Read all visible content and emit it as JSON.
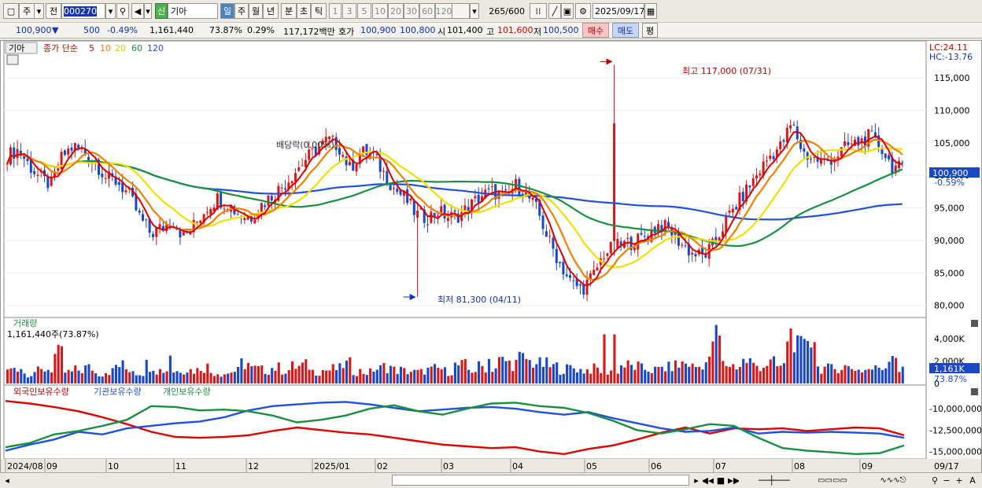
{
  "toolbar": {
    "type_label": "주",
    "prev_label": "전",
    "stock_code": "000270",
    "badge": "신",
    "stock_name": "기아",
    "periods": [
      "일",
      "주",
      "월",
      "년",
      "분",
      "초",
      "틱"
    ],
    "selected_period": "일",
    "minute_presets": [
      "1",
      "3",
      "5",
      "10",
      "20",
      "30",
      "60",
      "120"
    ],
    "count_display": "265",
    "count_max": "/600",
    "date": "2025/09/17"
  },
  "quote": {
    "price": "100,900",
    "arrow": "▼",
    "change": "500",
    "change_pct": "-0.49%",
    "volume": "1,161,440",
    "volume_ratio": "73.87%",
    "turnover": "0.29%",
    "amount": "117,172백만",
    "hoga_label": "호가",
    "ask": "100,900",
    "bid": "100,800",
    "open_label": "시",
    "open": "101,400",
    "high_label": "고",
    "high": "101,600",
    "low_label": "저",
    "low": "100,500",
    "buy_label": "매수",
    "sell_label": "매도",
    "eval_label": "평"
  },
  "price_panel": {
    "name_tag": "기아",
    "ma_title": "종가 단순",
    "ma_periods": [
      "5",
      "10",
      "20",
      "60",
      "120"
    ],
    "lc_label": "LC:24.11",
    "hc_label": "HC:-13.76",
    "y_ticks": [
      "115,000",
      "110,000",
      "105,000",
      "100,000",
      "95,000",
      "90,000",
      "85,000",
      "80,000"
    ],
    "current_price": "100,900",
    "current_pct": "-0.59%",
    "high_annotation": "최고 117,000 (07/31)",
    "low_annotation": "최저 81,300 (04/11)",
    "dividend_annotation": "배당락(0.00%)"
  },
  "volume_panel": {
    "title": "거래량",
    "value": "1,161,440주(73.87%)",
    "y_ticks": [
      "4,000K",
      "2,000K",
      "0"
    ],
    "current": "1,161K",
    "current_pct": "73.87%"
  },
  "holdings_panel": {
    "series_labels": [
      "외국인보유수량",
      "기관보유수량",
      "개인보유수량"
    ],
    "y_ticks": [
      "-10,000,000",
      "-12,500,000",
      "-15,000,000"
    ]
  },
  "x_axis": {
    "ticks": [
      "2024/08",
      "09",
      "10",
      "11",
      "12",
      "2025/01",
      "02",
      "03",
      "04",
      "05",
      "06",
      "07",
      "08",
      "09"
    ],
    "end_label": "09/17"
  },
  "colors": {
    "up": "#d81818",
    "down": "#1848c8",
    "ma5": "#e00000",
    "ma10": "#f08000",
    "ma20": "#f0e000",
    "ma60": "#189040",
    "ma120": "#2050e0",
    "foreign": "#e00000",
    "institution": "#2050e0",
    "individual": "#189040"
  },
  "chart_data": [
    {
      "type": "candlestick",
      "title": "기아 종가 단순",
      "x_range": [
        "2024/08",
        "2025/09/17"
      ],
      "ylim": [
        79000,
        118500
      ],
      "series": [
        {
          "name": "5",
          "values": []
        },
        {
          "name": "10",
          "values": []
        },
        {
          "name": "20",
          "values": []
        },
        {
          "name": "60",
          "values": []
        },
        {
          "name": "120",
          "values": []
        }
      ],
      "closes": [
        103000,
        104000,
        101500,
        99500,
        98500,
        103000,
        104500,
        103500,
        102000,
        99500,
        99000,
        97000,
        93500,
        91000,
        92000,
        93000,
        90500,
        92500,
        95000,
        96500,
        95500,
        94000,
        93500,
        95500,
        97000,
        98500,
        100500,
        102500,
        104000,
        105500,
        104500,
        101000,
        103500,
        103500,
        100500,
        98000,
        96500,
        94000,
        93500,
        94500,
        93500,
        94000,
        95500,
        97000,
        97500,
        96500,
        98500,
        97000,
        94500,
        90000,
        86500,
        83500,
        82500,
        84500,
        88000,
        89000,
        89500,
        90000,
        91000,
        92500,
        91500,
        89500,
        88000,
        87500,
        89500,
        93000,
        95500,
        98000,
        100500,
        103000,
        104500,
        108000,
        103500,
        102500,
        102000,
        103000,
        104500,
        105000,
        106000,
        104500,
        101500,
        100900
      ],
      "candles": [],
      "annotations": {
        "high": 117000,
        "high_date": "07/31",
        "low": 81300,
        "low_date": "04/11"
      }
    },
    {
      "type": "bar",
      "title": "거래량",
      "unit": "K",
      "ylim": [
        0,
        5000
      ],
      "values": [
        1200,
        1500,
        900,
        1100,
        1300,
        2500,
        1000,
        1200,
        1400,
        900,
        1100,
        1600,
        1300,
        1000,
        1700,
        1200,
        1100,
        1300,
        1200,
        1500,
        1000,
        900,
        1100,
        1800,
        1300,
        1200,
        1400,
        1200,
        1500,
        1600,
        1100,
        1200,
        1300,
        1700,
        1100,
        1000,
        1300,
        1500,
        1200,
        1100,
        1000,
        1200,
        1300,
        1100,
        1600,
        1200,
        1500,
        1400,
        2000,
        1800,
        2200,
        1900,
        1700,
        1500,
        1300,
        1400,
        1200,
        1300,
        1100,
        1200,
        1600,
        1500,
        1300,
        1200,
        1400,
        1600,
        1800,
        1500,
        1900,
        4100,
        1700,
        1600,
        2000,
        1600,
        1800,
        1500,
        4400,
        3100,
        4300,
        1400,
        1300,
        1500,
        1400,
        1200,
        1300,
        1500,
        2800,
        1161
      ]
    },
    {
      "type": "line",
      "title": "보유수량",
      "ylim": [
        -15500000,
        -8800000
      ],
      "series": [
        {
          "name": "외국인보유수량",
          "values": [
            -9100000,
            -9400000,
            -9800000,
            -10300000,
            -11000000,
            -11800000,
            -12700000,
            -13300000,
            -13400000,
            -13300000,
            -13100000,
            -12600000,
            -12200000,
            -12500000,
            -12800000,
            -13000000,
            -13400000,
            -13800000,
            -14200000,
            -14400000,
            -14600000,
            -14500000,
            -15000000,
            -15300000,
            -14700000,
            -14300000,
            -13600000,
            -12800000,
            -12200000,
            -12900000,
            -12300000,
            -12400000,
            -12300000,
            -12600000,
            -12400000,
            -12200000,
            -12300000,
            -13100000
          ]
        },
        {
          "name": "기관보유수량",
          "values": [
            -14900000,
            -14200000,
            -13600000,
            -12700000,
            -13000000,
            -12300000,
            -12000000,
            -11700000,
            -11500000,
            -11000000,
            -10200000,
            -9700000,
            -9500000,
            -9300000,
            -9200000,
            -9500000,
            -9900000,
            -10300000,
            -10100000,
            -9900000,
            -9800000,
            -10000000,
            -10400000,
            -10700000,
            -10400000,
            -11100000,
            -11700000,
            -12300000,
            -12700000,
            -12600000,
            -12200000,
            -12900000,
            -12700000,
            -12800000,
            -12700000,
            -12800000,
            -12900000,
            -13400000
          ]
        },
        {
          "name": "개인보유수량",
          "values": [
            -14500000,
            -14000000,
            -13000000,
            -12600000,
            -12000000,
            -11300000,
            -9700000,
            -9800000,
            -10200000,
            -10100000,
            -10300000,
            -10800000,
            -11600000,
            -11300000,
            -10800000,
            -10000000,
            -9600000,
            -10300000,
            -10700000,
            -10000000,
            -9400000,
            -9300000,
            -9700000,
            -9900000,
            -10500000,
            -11400000,
            -12500000,
            -12900000,
            -12400000,
            -11800000,
            -12000000,
            -13400000,
            -14600000,
            -14900000,
            -15100000,
            -15300000,
            -15200000,
            -14300000
          ]
        }
      ]
    }
  ]
}
